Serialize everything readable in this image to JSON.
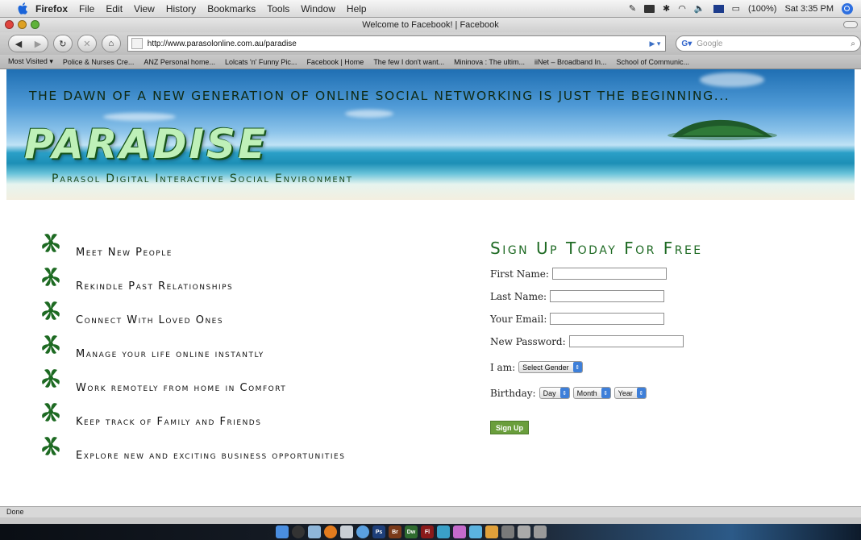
{
  "menubar": {
    "app_name": "Firefox",
    "items": [
      "File",
      "Edit",
      "View",
      "History",
      "Bookmarks",
      "Tools",
      "Window",
      "Help"
    ],
    "battery": "(100%)",
    "clock": "Sat 3:35 PM"
  },
  "window": {
    "title": "Welcome to Facebook! | Facebook"
  },
  "navbar": {
    "url": "http://www.parasolonline.com.au/paradise",
    "search_placeholder": "Google"
  },
  "bookmarks": [
    "Most Visited ▾",
    "Police & Nurses Cre...",
    "ANZ Personal home...",
    "Lolcats 'n' Funny Pic...",
    "Facebook | Home",
    "The few I don't want...",
    "Mininova : The ultim...",
    "iiNet – Broadband In...",
    "School of Communic..."
  ],
  "banner": {
    "tagline": "The dawn of a new generation of online social networking is just the beginning...",
    "logo": "PARADISE",
    "subtitle": "Parasol Digital Interactive Social Environment"
  },
  "features": [
    "Meet New People",
    "Rekindle Past Relationships",
    "Connect With Loved Ones",
    "Manage your life online instantly",
    "Work remotely from home in Comfort",
    "Keep track of Family and Friends",
    "Explore new and exciting business opportunities"
  ],
  "signup": {
    "heading": "Sign Up Today For Free",
    "first_name_label": "First Name:",
    "last_name_label": "Last Name:",
    "email_label": "Your Email:",
    "password_label": "New Password:",
    "gender_label": "I am:",
    "gender_value": "Select Gender",
    "birthday_label": "Birthday:",
    "day_value": "Day",
    "month_value": "Month",
    "year_value": "Year",
    "button_label": "Sign Up"
  },
  "status": {
    "text": "Done"
  },
  "colors": {
    "accent_green": "#1e6a23",
    "button_green": "#6a9e3c"
  }
}
